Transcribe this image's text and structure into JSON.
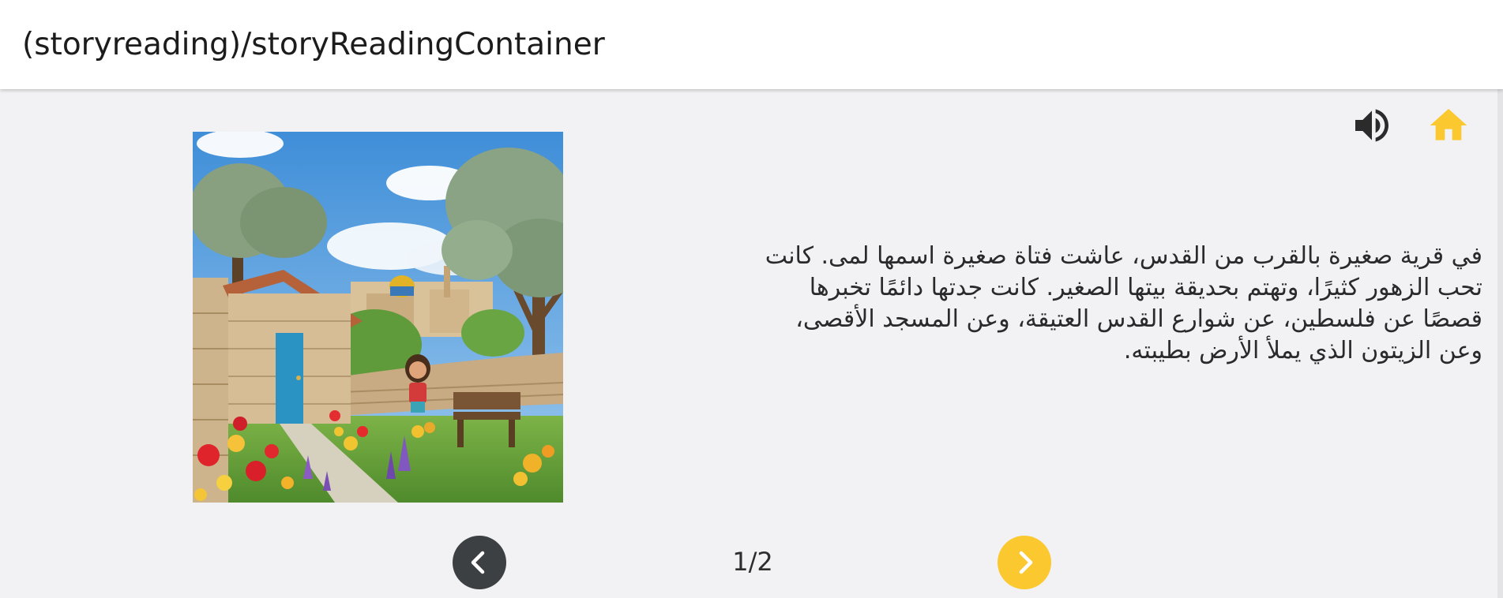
{
  "header": {
    "title": "(storyreading)/storyReadingContainer"
  },
  "toolbar": {
    "sound_icon": "volume-up-icon",
    "home_icon": "home-icon"
  },
  "story": {
    "text": "في قرية صغيرة بالقرب من القدس، عاشت فتاة صغيرة اسمها لمى. كانت تحب الزهور كثيرًا، وتهتم بحديقة بيتها الصغير. كانت جدتها دائمًا تخبرها قصصًا عن فلسطين، عن شوارع القدس العتيقة، وعن المسجد الأقصى، وعن الزيتون الذي يملأ الأرض بطيبته.",
    "illustration_icon": "story-illustration"
  },
  "pagination": {
    "indicator": "1/2",
    "prev_icon": "chevron-left-icon",
    "next_icon": "chevron-right-icon"
  },
  "colors": {
    "accent": "#fbc82f",
    "dark_button": "#3c4043",
    "background": "#f2f1f3",
    "header_bg": "#ffffff"
  }
}
